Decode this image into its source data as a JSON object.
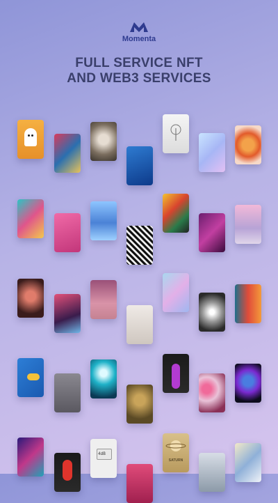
{
  "brand": {
    "name": "Momenta"
  },
  "headline": {
    "line1": "FULL SERVICE NFT",
    "line2": "AND WEB3 SERVICES"
  },
  "tiles": {
    "pc_label": "4dB",
    "saturn_label": "SATURN"
  },
  "colors": {
    "brand": "#2f3b8f",
    "headline": "#3a3f6b"
  }
}
